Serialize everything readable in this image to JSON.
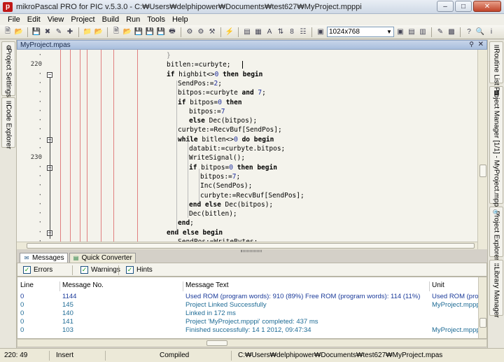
{
  "window": {
    "title": "mikroPascal PRO for PIC v.5.3.0 - C:₩Users₩delphipower₩Documents₩test627₩MyProject.mpppi"
  },
  "menu": [
    "File",
    "Edit",
    "View",
    "Project",
    "Build",
    "Run",
    "Tools",
    "Help"
  ],
  "toolbar": {
    "resolution": "1024x768"
  },
  "left_tabs": [
    "Project Settings",
    "Code Explorer"
  ],
  "right_tabs": [
    "Routine List",
    "Project Manager [1/1] - MyProject.mpppi",
    "Project Explorer",
    "Library Manager"
  ],
  "editor": {
    "tab_title": "MyProject.mpas",
    "line_numbers": [
      "220",
      "230"
    ],
    "lines": [
      {
        "text": "}",
        "style": "greyed"
      },
      {
        "text": "bitlen:=curbyte;"
      },
      {
        "text": "if highbit<>0 then begin"
      },
      {
        "text": "SendPos:=2;"
      },
      {
        "text": "bitpos:=curbyte and 7;"
      },
      {
        "text": "if bitpos=0 then"
      },
      {
        "text": "bitpos:=7"
      },
      {
        "text": "else Dec(bitpos);"
      },
      {
        "text": "curbyte:=RecvBuf[SendPos];"
      },
      {
        "text": "while bitlen<>0 do begin"
      },
      {
        "text": "databit:=curbyte.bitpos;"
      },
      {
        "text": "WriteSignal();"
      },
      {
        "text": "if bitpos=0 then begin"
      },
      {
        "text": "bitpos:=7;"
      },
      {
        "text": "Inc(SendPos);"
      },
      {
        "text": "curbyte:=RecvBuf[SendPos];"
      },
      {
        "text": "end else Dec(bitpos);"
      },
      {
        "text": "Dec(bitlen);"
      },
      {
        "text": "end;"
      },
      {
        "text": "end else begin"
      },
      {
        "text": "SendPos:=WriteBytes;"
      }
    ]
  },
  "bottom": {
    "tabs": [
      "Messages",
      "Quick Converter"
    ],
    "filters": [
      "Errors",
      "Warnings",
      "Hints"
    ],
    "columns": [
      "Line",
      "Message No.",
      "Message Text",
      "Unit"
    ],
    "rows": [
      {
        "line": "0",
        "no": "1144",
        "text": "Used ROM (program words): 910 (89%)  Free ROM (program words): 114 (11%)",
        "unit": "Used ROM (program"
      },
      {
        "line": "0",
        "no": "145",
        "text": "Project Linked Successfully",
        "unit": "MyProject.mpppi"
      },
      {
        "line": "0",
        "no": "140",
        "text": "Linked in 172 ms",
        "unit": ""
      },
      {
        "line": "0",
        "no": "141",
        "text": "Project 'MyProject.mpppi' completed: 437 ms",
        "unit": ""
      },
      {
        "line": "0",
        "no": "103",
        "text": "Finished successfully: 14 1 2012, 09:47:34",
        "unit": "MyProject.mpppi"
      }
    ]
  },
  "status": {
    "position": "220: 49",
    "mode": "Insert",
    "state": "Compiled",
    "path": "C:₩Users₩delphipower₩Documents₩test627₩MyProject.mpas"
  }
}
